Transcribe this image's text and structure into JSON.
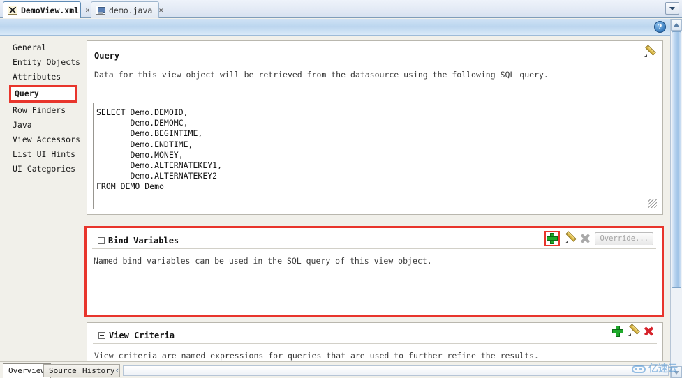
{
  "window": {
    "tabs": [
      {
        "label": "DemoView.xml",
        "icon": "xml-file-icon",
        "active": true,
        "close": "×"
      },
      {
        "label": "demo.java",
        "icon": "java-file-icon",
        "active": false,
        "close": "×"
      }
    ],
    "tabstrip_dropdown_icon": "chevron-down-icon",
    "help_icon": "help-question-icon",
    "help_label": "?"
  },
  "sidebar": {
    "items": [
      {
        "label": "General",
        "selected": false
      },
      {
        "label": "Entity Objects",
        "selected": false
      },
      {
        "label": "Attributes",
        "selected": false
      },
      {
        "label": "Query",
        "selected": true
      },
      {
        "label": "Row Finders",
        "selected": false
      },
      {
        "label": "Java",
        "selected": false
      },
      {
        "label": "View Accessors",
        "selected": false
      },
      {
        "label": "List UI Hints",
        "selected": false
      },
      {
        "label": "UI Categories",
        "selected": false
      }
    ]
  },
  "query_section": {
    "title": "Query",
    "description": "Data for this view object will be retrieved from the datasource using the following SQL query.",
    "edit_icon": "pencil-edit-icon",
    "sql": "SELECT Demo.DEMOID,\n       Demo.DEMOMC,\n       Demo.BEGINTIME,\n       Demo.ENDTIME,\n       Demo.MONEY,\n       Demo.ALTERNATEKEY1,\n       Demo.ALTERNATEKEY2\nFROM DEMO Demo"
  },
  "bind_variables_section": {
    "title": "Bind Variables",
    "description": "Named bind variables can be used in the SQL query of this view object.",
    "collapse_icon": "collapse-minus-icon",
    "tools": {
      "add_icon": "green-plus-add-icon",
      "edit_icon": "pencil-edit-icon",
      "delete_icon": "gray-x-delete-icon",
      "override_label": "Override..."
    }
  },
  "view_criteria_section": {
    "title": "View Criteria",
    "description": "View criteria are named expressions for queries that are used to further refine the results.",
    "collapse_icon": "collapse-minus-icon",
    "tools": {
      "add_icon": "green-plus-add-icon",
      "edit_icon": "pencil-edit-icon",
      "delete_icon": "red-x-delete-icon"
    }
  },
  "bottom_tabs": {
    "items": [
      {
        "label": "Overview",
        "active": true
      },
      {
        "label": "Source",
        "active": false
      },
      {
        "label": "History",
        "active": false
      }
    ],
    "scroll_left_icon": "chevron-left-icon",
    "scroll_left_glyph": "‹"
  },
  "scrollbar": {
    "up_icon": "scroll-up-arrow-icon",
    "down_icon": "scroll-down-arrow-icon",
    "thumb_name": "vertical-scroll-thumb"
  },
  "watermark": {
    "text": "亿速云",
    "logo_icon": "cloud-logo-icon"
  },
  "colors": {
    "highlight_red": "#e8352c",
    "add_green": "#1faa2b",
    "delete_red": "#d6232b",
    "accent_blue": "#2f74b8"
  }
}
